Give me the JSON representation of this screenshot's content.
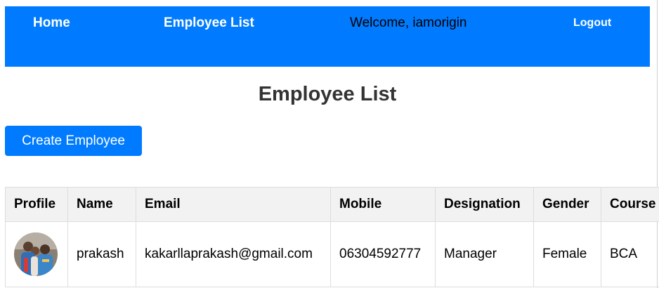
{
  "nav": {
    "home": "Home",
    "employee_list": "Employee List",
    "welcome": "Welcome, iamorigin",
    "logout": "Logout"
  },
  "page": {
    "title": "Employee List",
    "create_button": "Create Employee"
  },
  "table": {
    "headers": [
      "Profile",
      "Name",
      "Email",
      "Mobile",
      "Designation",
      "Gender",
      "Course"
    ],
    "rows": [
      {
        "name": "prakash",
        "email": "kakarllaprakash@gmail.com",
        "mobile": "06304592777",
        "designation": "Manager",
        "gender": "Female",
        "course": "BCA"
      }
    ]
  },
  "colors": {
    "primary": "#007bff",
    "header_bg": "#f2f2f2",
    "title_text": "#333333"
  }
}
